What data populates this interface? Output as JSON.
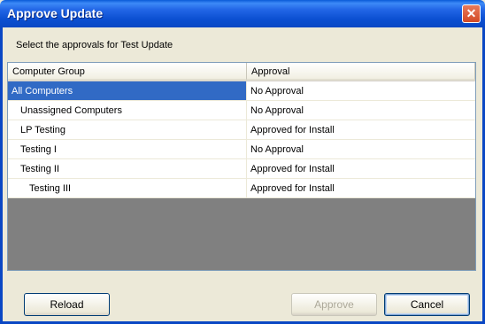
{
  "window": {
    "title": "Approve Update",
    "close_glyph": "✕"
  },
  "prompt": "Select the approvals for Test Update",
  "grid": {
    "columns": [
      "Computer Group",
      "Approval"
    ],
    "rows": [
      {
        "name": "All Computers",
        "approval": "No Approval",
        "level": 0,
        "selected": true
      },
      {
        "name": "Unassigned Computers",
        "approval": "No Approval",
        "level": 1,
        "selected": false
      },
      {
        "name": "LP Testing",
        "approval": "Approved for Install",
        "level": 1,
        "selected": false
      },
      {
        "name": "Testing I",
        "approval": "No Approval",
        "level": 1,
        "selected": false
      },
      {
        "name": "Testing II",
        "approval": "Approved for Install",
        "level": 1,
        "selected": false
      },
      {
        "name": "Testing III",
        "approval": "Approved for Install",
        "level": 2,
        "selected": false
      }
    ]
  },
  "buttons": {
    "reload": "Reload",
    "approve": "Approve",
    "cancel": "Cancel",
    "approve_enabled": false
  }
}
